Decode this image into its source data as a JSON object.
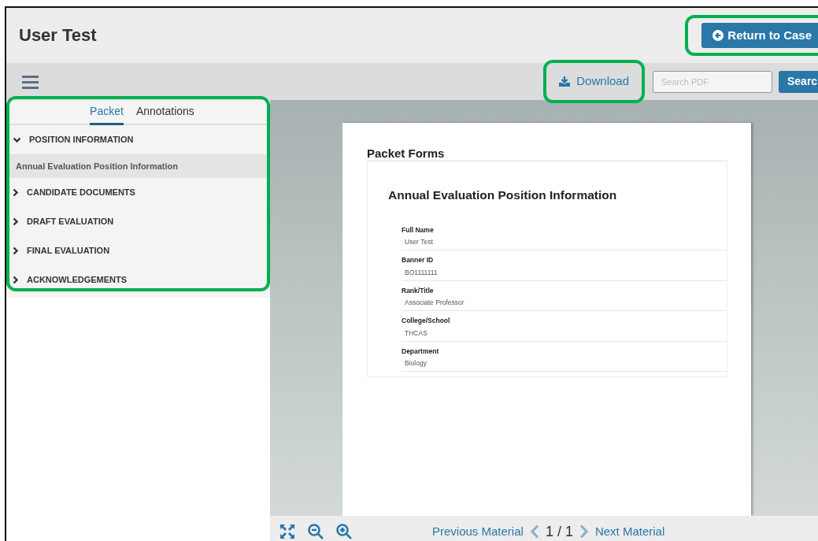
{
  "header": {
    "title": "User Test",
    "return_button": {
      "label": "Return to Case",
      "highlighted": true
    }
  },
  "toolbar": {
    "download": {
      "label": "Download",
      "highlighted": true
    },
    "search": {
      "placeholder": "Search PDF"
    },
    "search_button": "Searc"
  },
  "sidebar": {
    "highlighted": true,
    "tabs": [
      {
        "label": "Packet",
        "selected": true
      },
      {
        "label": "Annotations",
        "selected": false
      }
    ],
    "sections": [
      {
        "label": "POSITION INFORMATION",
        "expanded": true,
        "children": [
          {
            "label": "Annual Evaluation Position Information",
            "selected": true
          }
        ]
      },
      {
        "label": "CANDIDATE DOCUMENTS",
        "expanded": false
      },
      {
        "label": "DRAFT EVALUATION",
        "expanded": false
      },
      {
        "label": "FINAL EVALUATION",
        "expanded": false
      },
      {
        "label": "ACKNOWLEDGEMENTS",
        "expanded": false
      }
    ]
  },
  "document": {
    "title": "Packet Forms",
    "form_title": "Annual Evaluation Position Information",
    "fields": [
      {
        "label": "Full Name",
        "value": "User Test"
      },
      {
        "label": "Banner ID",
        "value": "BO1111111"
      },
      {
        "label": "Rank/Title",
        "value": "Associate Professor"
      },
      {
        "label": "College/School",
        "value": "THCAS"
      },
      {
        "label": "Department",
        "value": "Biology"
      }
    ]
  },
  "pager": {
    "previous": "Previous Material",
    "page": "1 / 1",
    "next": "Next Material"
  }
}
